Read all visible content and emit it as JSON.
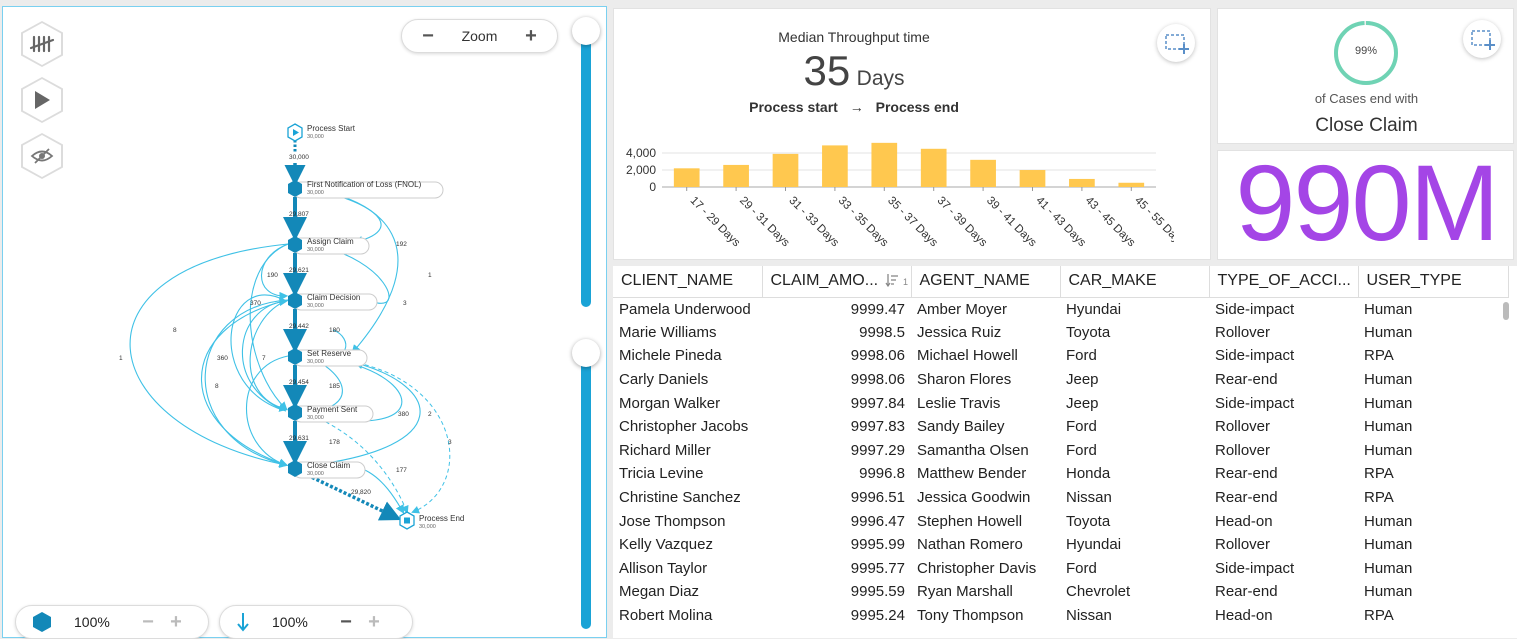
{
  "process_map": {
    "zoom_label": "Zoom",
    "zoom_minus": "−",
    "zoom_plus": "+",
    "nodes": [
      {
        "label": "Process Start",
        "count": "30,000"
      },
      {
        "label": "First Notification of Loss (FNOL)",
        "count": "30,000"
      },
      {
        "label": "Assign Claim",
        "count": "30,000"
      },
      {
        "label": "Claim Decision",
        "count": "30,000"
      },
      {
        "label": "Set Reserve",
        "count": "30,000"
      },
      {
        "label": "Payment Sent",
        "count": "30,000"
      },
      {
        "label": "Close Claim",
        "count": "30,000"
      },
      {
        "label": "Process End",
        "count": "30,000"
      }
    ],
    "edge_labels": {
      "start_fnol": "30,000",
      "fnol_assign": "29,807",
      "assign_decision": "29,621",
      "decision_reserve": "29,442",
      "reserve_payment": "29,454",
      "payment_close": "29,631",
      "close_end": "29,820",
      "l192": "192",
      "l1a": "1",
      "l190": "190",
      "l370": "370",
      "l3a": "3",
      "l180": "180",
      "l8a": "8",
      "l1b": "1",
      "l360": "360",
      "l7": "7",
      "l8b": "8",
      "l185": "185",
      "l380": "380",
      "l2": "2",
      "l178": "178",
      "l3b": "3",
      "l177": "177"
    },
    "bottom_left": {
      "value": "100%",
      "minus": "−",
      "plus": "+"
    },
    "bottom_right": {
      "value": "100%",
      "minus": "−",
      "plus": "+"
    }
  },
  "throughput": {
    "title": "Median Throughput time",
    "value": "35",
    "unit": "Days",
    "from": "Process start",
    "arrow": "→",
    "to": "Process end"
  },
  "chart_data": {
    "type": "bar",
    "categories": [
      "17 - 29 Days",
      "29 - 31 Days",
      "31 - 33 Days",
      "33 - 35 Days",
      "35 - 37 Days",
      "37 - 39 Days",
      "39 - 41 Days",
      "41 - 43 Days",
      "43 - 45 Days",
      "45 - 55 Days"
    ],
    "values": [
      2200,
      2600,
      3900,
      4900,
      5200,
      4500,
      3200,
      2000,
      950,
      500
    ],
    "yticks": [
      "4,000",
      "2,000",
      "0"
    ],
    "ytick_values": [
      4000,
      2000,
      0
    ],
    "ylim": [
      0,
      5300
    ],
    "bar_color": "#ffc84f"
  },
  "close_claim": {
    "percent": "99%",
    "caption": "of Cases end with",
    "activity": "Close Claim",
    "ring_color": "#6fd3b4"
  },
  "big_number": {
    "value": "990M",
    "color": "#a445e6"
  },
  "table": {
    "columns": [
      "CLIENT_NAME",
      "CLAIM_AMO...",
      "AGENT_NAME",
      "CAR_MAKE",
      "TYPE_OF_ACCI...",
      "USER_TYPE"
    ],
    "sort_index": "1",
    "rows": [
      [
        "Pamela Underwood",
        "9999.47",
        "Amber Moyer",
        "Hyundai",
        "Side-impact",
        "Human"
      ],
      [
        "Marie Williams",
        "9998.5",
        "Jessica Ruiz",
        "Toyota",
        "Rollover",
        "Human"
      ],
      [
        "Michele Pineda",
        "9998.06",
        "Michael Howell",
        "Ford",
        "Side-impact",
        "RPA"
      ],
      [
        "Carly Daniels",
        "9998.06",
        "Sharon Flores",
        "Jeep",
        "Rear-end",
        "Human"
      ],
      [
        "Morgan Walker",
        "9997.84",
        "Leslie Travis",
        "Jeep",
        "Side-impact",
        "Human"
      ],
      [
        "Christopher Jacobs",
        "9997.83",
        "Sandy Bailey",
        "Ford",
        "Rollover",
        "Human"
      ],
      [
        "Richard Miller",
        "9997.29",
        "Samantha Olsen",
        "Ford",
        "Rollover",
        "Human"
      ],
      [
        "Tricia Levine",
        "9996.8",
        "Matthew Bender",
        "Honda",
        "Rear-end",
        "RPA"
      ],
      [
        "Christine Sanchez",
        "9996.51",
        "Jessica Goodwin",
        "Nissan",
        "Rear-end",
        "RPA"
      ],
      [
        "Jose Thompson",
        "9996.47",
        "Stephen Howell",
        "Toyota",
        "Head-on",
        "Human"
      ],
      [
        "Kelly Vazquez",
        "9995.99",
        "Nathan Romero",
        "Hyundai",
        "Rollover",
        "Human"
      ],
      [
        "Allison Taylor",
        "9995.77",
        "Christopher Davis",
        "Ford",
        "Side-impact",
        "Human"
      ],
      [
        "Megan Diaz",
        "9995.59",
        "Ryan Marshall",
        "Chevrolet",
        "Rear-end",
        "Human"
      ],
      [
        "Robert Molina",
        "9995.24",
        "Tony Thompson",
        "Nissan",
        "Head-on",
        "RPA"
      ]
    ]
  },
  "colors": {
    "accent": "#1aa3d6",
    "node": "#1388b8",
    "edge": "#3fc1e6"
  }
}
